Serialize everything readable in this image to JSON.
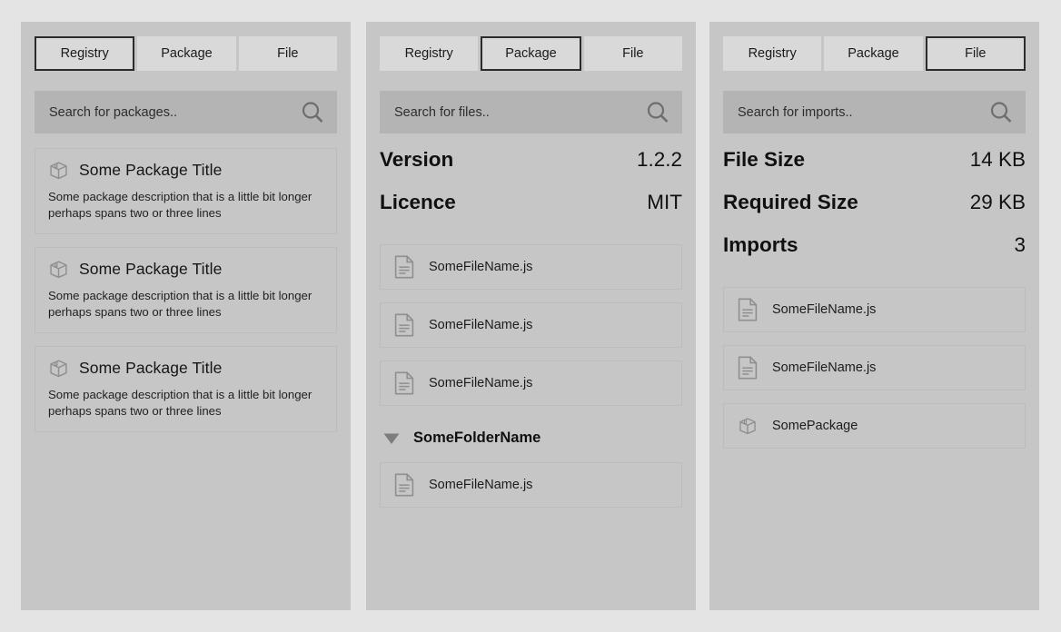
{
  "panels": [
    {
      "name": "registry",
      "tabs": [
        {
          "label": "Registry",
          "active": true
        },
        {
          "label": "Package",
          "active": false
        },
        {
          "label": "File",
          "active": false
        }
      ],
      "search": {
        "placeholder": "Search for packages..",
        "icon": "search-icon"
      },
      "packages": [
        {
          "icon": "package-box-icon",
          "title": "Some Package Title",
          "description": "Some package description that is a little bit longer perhaps spans two or three lines"
        },
        {
          "icon": "package-box-icon",
          "title": "Some Package Title",
          "description": "Some package description that is a little bit longer perhaps spans two or three lines"
        },
        {
          "icon": "package-box-icon",
          "title": "Some Package Title",
          "description": "Some package description that is a little bit longer perhaps spans two or three lines"
        }
      ]
    },
    {
      "name": "package",
      "tabs": [
        {
          "label": "Registry",
          "active": false
        },
        {
          "label": "Package",
          "active": true
        },
        {
          "label": "File",
          "active": false
        }
      ],
      "search": {
        "placeholder": "Search for files..",
        "icon": "search-icon"
      },
      "details": [
        {
          "key": "Version",
          "value": "1.2.2"
        },
        {
          "key": "Licence",
          "value": "MIT"
        }
      ],
      "files": [
        {
          "icon": "file-document-icon",
          "label": "SomeFileName.js"
        },
        {
          "icon": "file-document-icon",
          "label": "SomeFileName.js"
        },
        {
          "icon": "file-document-icon",
          "label": "SomeFileName.js"
        }
      ],
      "folder": {
        "icon": "caret-down-icon",
        "name": "SomeFolderName",
        "expanded": true,
        "children": [
          {
            "icon": "file-document-icon",
            "label": "SomeFileName.js"
          }
        ]
      }
    },
    {
      "name": "file",
      "tabs": [
        {
          "label": "Registry",
          "active": false
        },
        {
          "label": "Package",
          "active": false
        },
        {
          "label": "File",
          "active": true
        }
      ],
      "search": {
        "placeholder": "Search for imports..",
        "icon": "search-icon"
      },
      "details": [
        {
          "key": "File Size",
          "value": "14 KB"
        },
        {
          "key": "Required Size",
          "value": "29 KB"
        },
        {
          "key": "Imports",
          "value": "3"
        }
      ],
      "imports": [
        {
          "icon": "file-document-icon",
          "label": "SomeFileName.js"
        },
        {
          "icon": "file-document-icon",
          "label": "SomeFileName.js"
        },
        {
          "icon": "package-box-icon",
          "label": "SomePackage"
        }
      ]
    }
  ],
  "colors": {
    "page_background": "#e4e4e4",
    "panel_background": "#c6c6c6",
    "tab_background": "#d9d9d9",
    "tab_active_border": "#2b2b2b",
    "search_background": "#b4b4b4",
    "row_border": "#bcbcbc",
    "icon_gray": "#8f8f8f",
    "text": "#151515"
  }
}
